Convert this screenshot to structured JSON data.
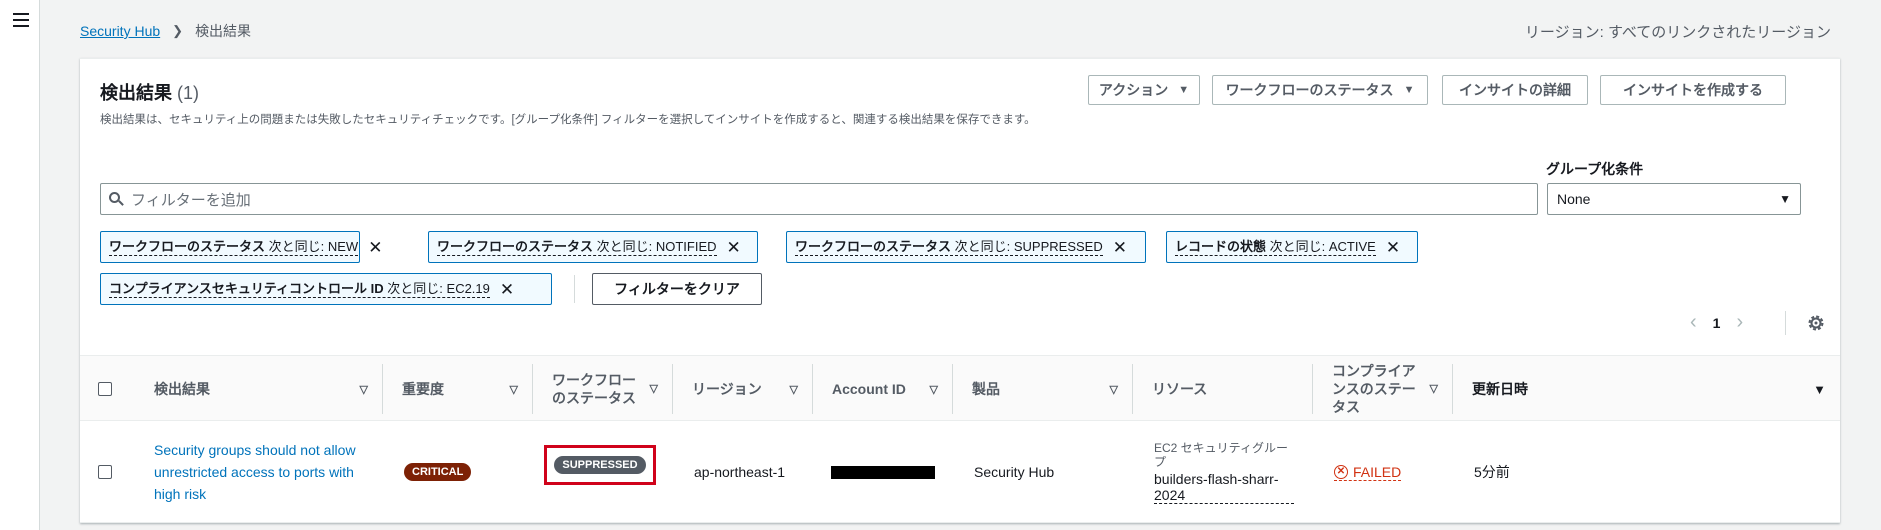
{
  "breadcrumb": {
    "root": "Security Hub",
    "current": "検出結果"
  },
  "region_label": "リージョン: すべてのリンクされたリージョン",
  "panel": {
    "title": "検出結果",
    "count": "(1)",
    "description": "検出結果は、セキュリティ上の問題または失敗したセキュリティチェックです。[グループ化条件] フィルターを選択してインサイトを作成すると、関連する検出結果を保存できます。",
    "actions_label": "アクション",
    "workflow_label": "ワークフローのステータス",
    "insight_details_label": "インサイトの詳細",
    "create_insight_label": "インサイトを作成する"
  },
  "filters": {
    "search_placeholder": "フィルターを追加",
    "group_by_label": "グループ化条件",
    "group_by_value": "None",
    "tokens": [
      {
        "key": "ワークフローのステータス",
        "op": "次と同じ: NEW"
      },
      {
        "key": "ワークフローのステータス",
        "op": "次と同じ: NOTIFIED"
      },
      {
        "key": "ワークフローのステータス",
        "op": "次と同じ: SUPPRESSED"
      },
      {
        "key": "レコードの状態",
        "op": "次と同じ: ACTIVE"
      },
      {
        "key": "コンプライアンスセキュリティコントロール ID",
        "op": "次と同じ: EC2.19"
      }
    ],
    "clear_label": "フィルターをクリア"
  },
  "pagination": {
    "page": "1"
  },
  "table": {
    "columns": [
      "検出結果",
      "重要度",
      "ワークフロー\nのステータス",
      "リージョン",
      "Account ID",
      "製品",
      "リソース",
      "コンプライア\nンスのステー\nタス",
      "更新日時"
    ],
    "rows": [
      {
        "title": "Security groups should not allow unrestricted access to ports with high risk",
        "severity": "CRITICAL",
        "workflow": "SUPPRESSED",
        "region": "ap-northeast-1",
        "product": "Security Hub",
        "resource_type": "EC2 セキュリティグループ",
        "resource_name": "builders-flash-sharr-2024",
        "compliance": "FAILED",
        "updated": "5分前"
      }
    ]
  },
  "colors": {
    "link": "#0073bb",
    "critical": "#7d2105",
    "failed": "#d13212",
    "highlight": "#d0021b"
  }
}
